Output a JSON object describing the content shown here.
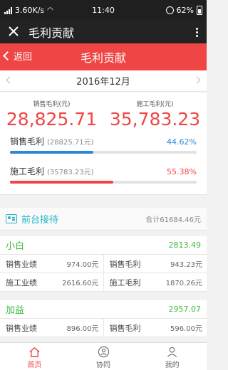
{
  "status": {
    "network": "3.60K/s",
    "time": "11:40",
    "battery": "62%"
  },
  "webview": {
    "title": "毛利贡献"
  },
  "appbar": {
    "back_label": "返回",
    "title": "毛利贡献"
  },
  "month": "2016年12月",
  "totals": [
    {
      "label": "销售毛利(元)",
      "value": "28,825.71"
    },
    {
      "label": "施工毛利(元)",
      "value": "35,783.23"
    }
  ],
  "bars": [
    {
      "label": "销售毛利",
      "sub": "(28825.71元)",
      "pct": "44.62%",
      "fraction": 0.4462,
      "color": "#2b87d8"
    },
    {
      "label": "施工毛利",
      "sub": "(35783.23元)",
      "pct": "55.38%",
      "fraction": 0.5538,
      "color": "#f04545"
    }
  ],
  "section": {
    "title": "前台接待",
    "total": "合计61684.46元"
  },
  "people": [
    {
      "name": "小白",
      "amount": "2813.49",
      "rows": [
        [
          {
            "label": "销售业绩",
            "value": "974.00元"
          },
          {
            "label": "销售毛利",
            "value": "943.23元"
          }
        ],
        [
          {
            "label": "施工业绩",
            "value": "2616.60元"
          },
          {
            "label": "施工毛利",
            "value": "1870.26元"
          }
        ]
      ]
    },
    {
      "name": "加益",
      "amount": "2957.07",
      "rows": [
        [
          {
            "label": "销售业绩",
            "value": "896.00元"
          },
          {
            "label": "销售毛利",
            "value": "596.00元"
          }
        ]
      ]
    }
  ],
  "tabs": [
    {
      "label": "首页",
      "icon": "home-icon",
      "active": true
    },
    {
      "label": "协同",
      "icon": "collaborate-icon",
      "active": false
    },
    {
      "label": "我的",
      "icon": "profile-icon",
      "active": false
    }
  ]
}
